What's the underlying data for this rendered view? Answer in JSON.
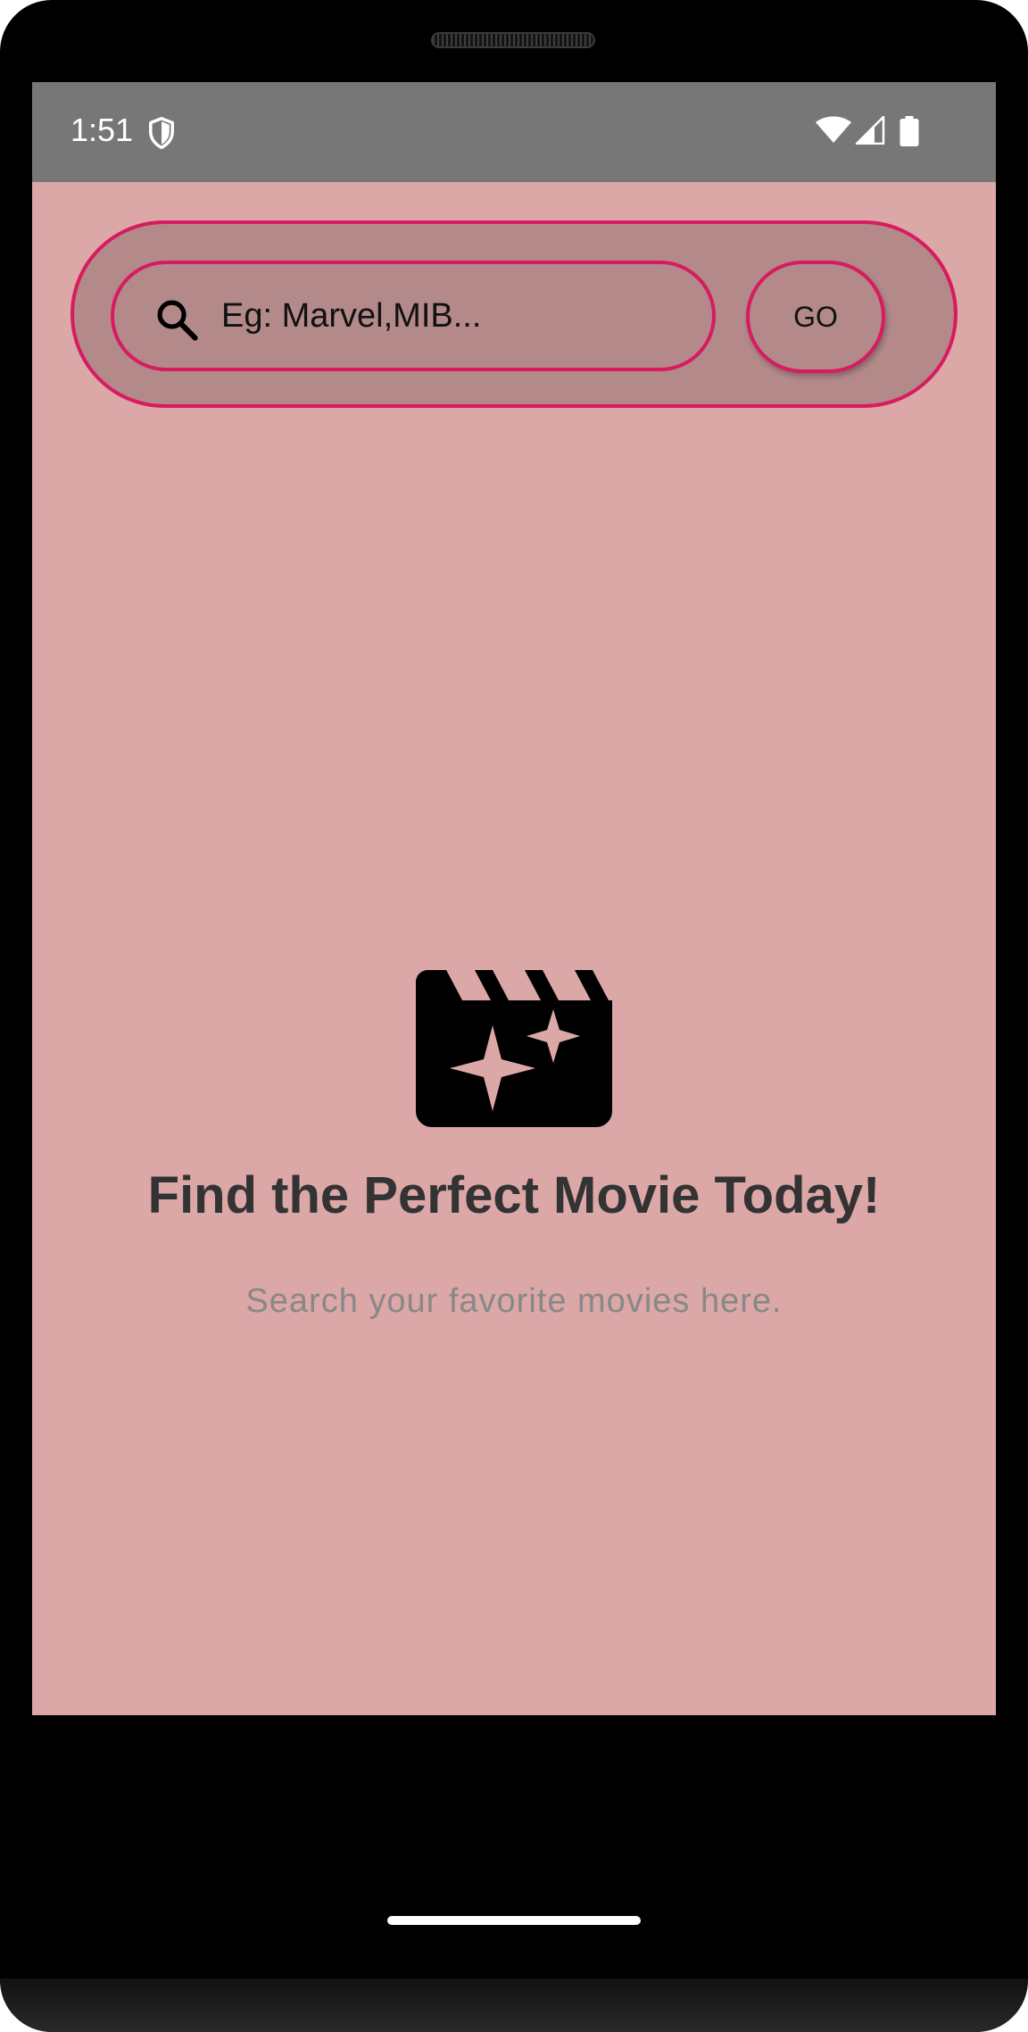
{
  "status_bar": {
    "time": "1:51",
    "icons": [
      "shield-icon",
      "wifi-icon",
      "signal-icon",
      "battery-icon"
    ]
  },
  "search": {
    "placeholder": "Eg: Marvel,MIB...",
    "icon": "search-icon",
    "go_label": "GO"
  },
  "empty_state": {
    "icon": "clapperboard-sparkle-icon",
    "title": "Find the Perfect Movie Today!",
    "subtitle": "Search your favorite movies here."
  },
  "colors": {
    "background": "#dba7a7",
    "card": "#b38989",
    "accent_border": "#d81b60",
    "status_bar": "#777777"
  }
}
